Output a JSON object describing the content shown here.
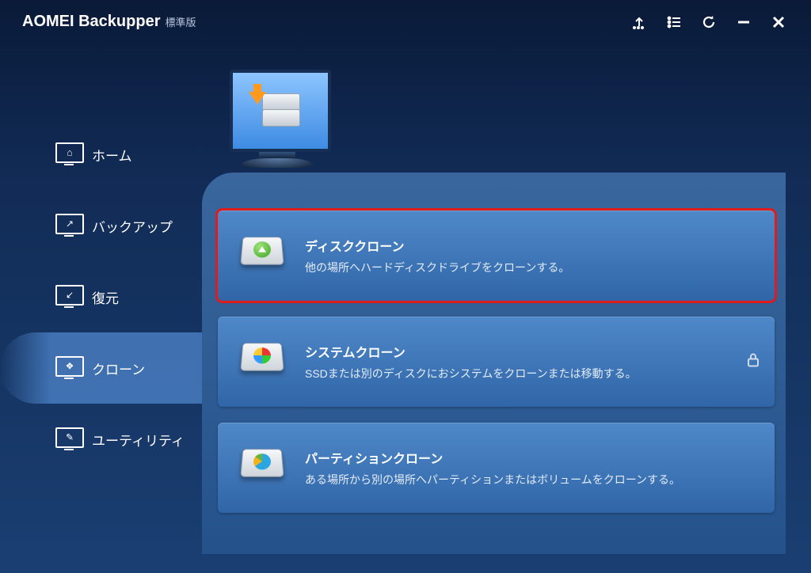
{
  "app": {
    "name": "AOMEI Backupper",
    "edition": "標準版"
  },
  "sidebar": {
    "items": [
      {
        "label": "ホーム"
      },
      {
        "label": "バックアップ"
      },
      {
        "label": "復元"
      },
      {
        "label": "クローン"
      },
      {
        "label": "ユーティリティ"
      }
    ],
    "active_index": 3
  },
  "clone": {
    "options": [
      {
        "title": "ディスククローン",
        "desc": "他の場所へハードディスクドライブをクローンする。",
        "locked": false,
        "highlighted": true,
        "icon": "disk-up"
      },
      {
        "title": "システムクローン",
        "desc": "SSDまたは別のディスクにおシステムをクローンまたは移動する。",
        "locked": true,
        "highlighted": false,
        "icon": "windows"
      },
      {
        "title": "パーティションクローン",
        "desc": "ある場所から別の場所へパーティションまたはボリュームをクローンする。",
        "locked": false,
        "highlighted": false,
        "icon": "pie"
      }
    ]
  }
}
